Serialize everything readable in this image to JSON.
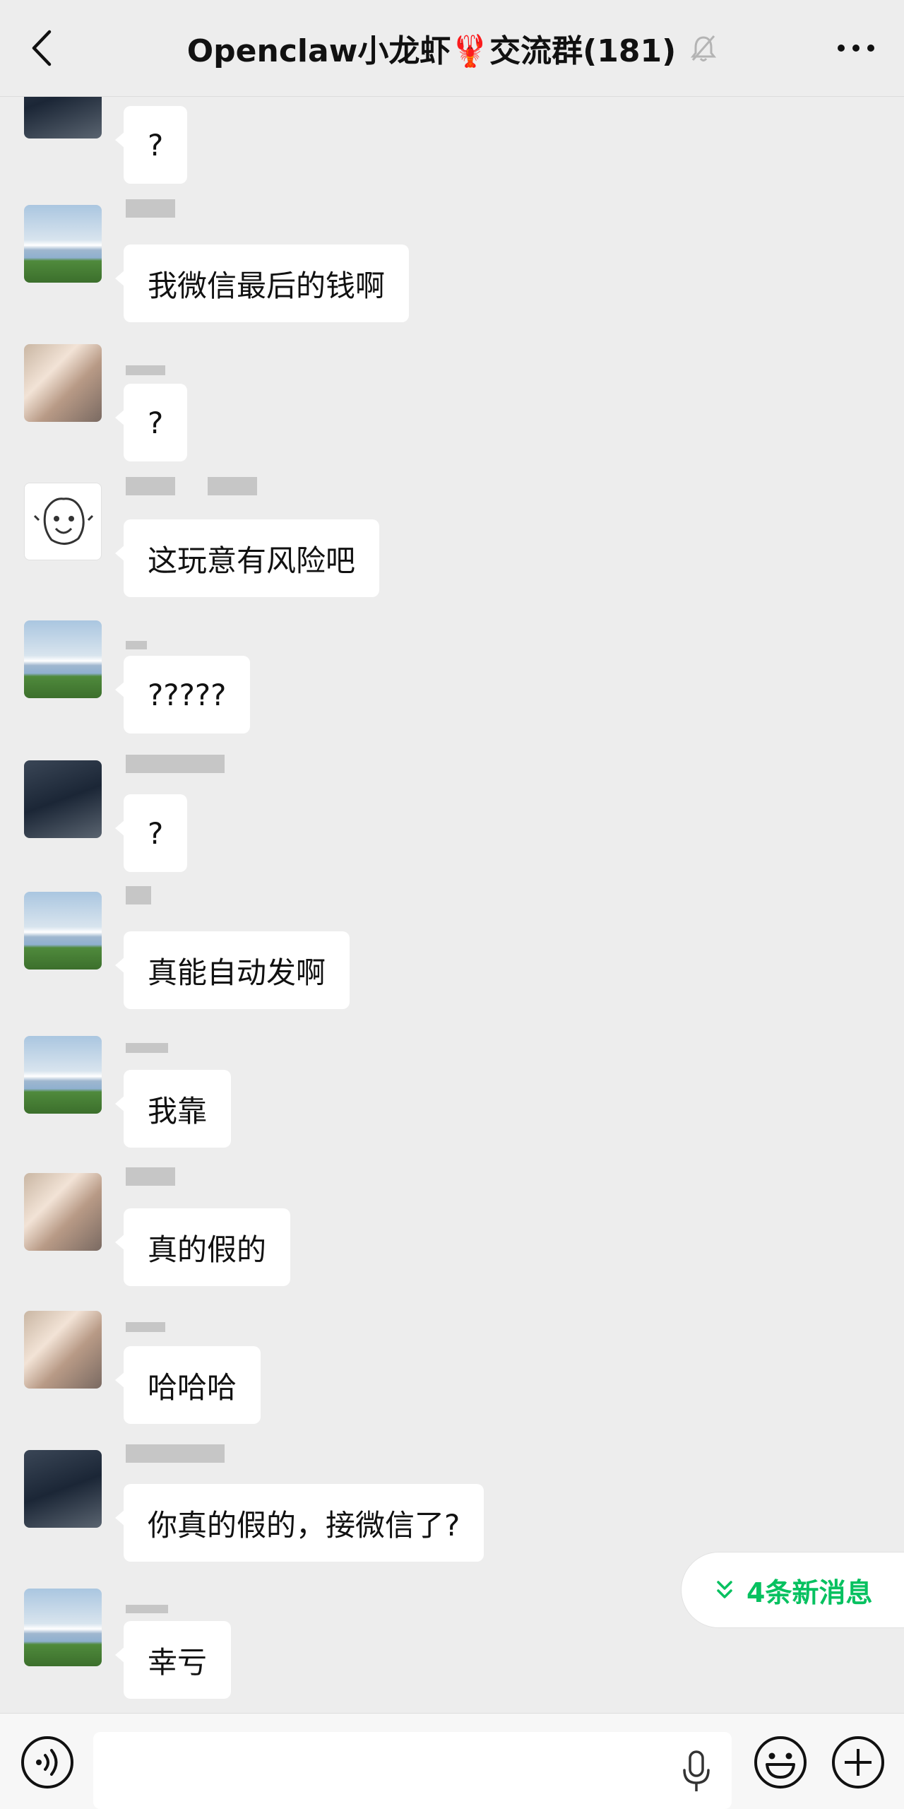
{
  "header": {
    "title": "Openclaw小龙虾🦞交流群(181)"
  },
  "messages": [
    {
      "text": "?",
      "avatar": "dark"
    },
    {
      "text": "我微信最后的钱啊",
      "avatar": "mountain"
    },
    {
      "text": "?",
      "avatar": "man"
    },
    {
      "text": "这玩意有风险吧",
      "avatar": "face"
    },
    {
      "text": "?????",
      "avatar": "mountain"
    },
    {
      "text": "?",
      "avatar": "dark"
    },
    {
      "text": "真能自动发啊",
      "avatar": "mountain"
    },
    {
      "text": "我靠",
      "avatar": "mountain"
    },
    {
      "text": "真的假的",
      "avatar": "man"
    },
    {
      "text": "哈哈哈",
      "avatar": "man"
    },
    {
      "text": "你真的假的，接微信了?",
      "avatar": "dark"
    },
    {
      "text": "幸亏",
      "avatar": "mountain"
    }
  ],
  "new_messages": {
    "label": "4条新消息",
    "color": "#07c160"
  },
  "icons": {
    "back": "chevron-left-icon",
    "mute": "bell-off-icon",
    "more": "more-dots-icon",
    "voice": "voice-icon",
    "mic": "mic-icon",
    "emoji": "emoji-icon",
    "plus": "plus-icon"
  }
}
